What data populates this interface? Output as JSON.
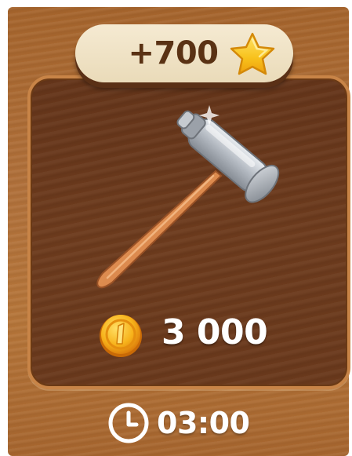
{
  "reward": {
    "label": "+700",
    "icon": "star-icon"
  },
  "item": {
    "icon": "hammer-icon"
  },
  "price": {
    "value": "3 000",
    "currency_icon": "coin-icon"
  },
  "timer": {
    "value": "03:00",
    "icon": "clock-icon"
  },
  "colors": {
    "card_wood": "#b0703a",
    "panel_wood": "#6a391c",
    "panel_border": "#c88447",
    "pill_bg": "#f0e4c8",
    "pill_text": "#5a3214",
    "star": "#f8c21c",
    "coin": "#f3a80f"
  }
}
